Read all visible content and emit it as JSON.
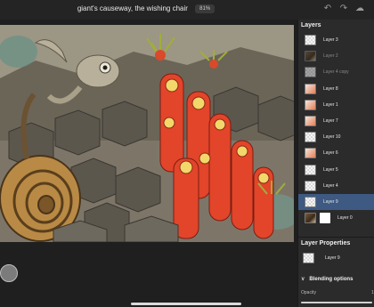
{
  "document": {
    "title": "giant's causeway, the wishing chair",
    "zoom": "81%"
  },
  "toolbar": {
    "undo_icon": "undo-icon",
    "redo_icon": "redo-icon",
    "cloud_icon": "cloud-icon"
  },
  "layers_panel": {
    "title": "Layers",
    "items": [
      {
        "label": "Layer 3",
        "thumb": "checker",
        "dim": false
      },
      {
        "label": "Layer 2",
        "thumb": "art",
        "dim": true
      },
      {
        "label": "Layer 4 copy",
        "thumb": "checker",
        "dim": true
      },
      {
        "label": "Layer 8",
        "thumb": "red",
        "dim": false
      },
      {
        "label": "Layer 1",
        "thumb": "red",
        "dim": false
      },
      {
        "label": "Layer 7",
        "thumb": "red",
        "dim": false
      },
      {
        "label": "Layer 10",
        "thumb": "checker",
        "dim": false
      },
      {
        "label": "Layer 6",
        "thumb": "red",
        "dim": false
      },
      {
        "label": "Layer 5",
        "thumb": "checker",
        "dim": false
      },
      {
        "label": "Layer 4",
        "thumb": "checker",
        "dim": false
      },
      {
        "label": "Layer 9",
        "thumb": "checker",
        "dim": false,
        "selected": true
      },
      {
        "label": "Layer 0",
        "thumb": "art",
        "dim": false,
        "mask": true
      }
    ]
  },
  "layer_properties": {
    "title": "Layer Properties",
    "layer_name": "Layer 9",
    "blending_title": "Blending options",
    "opacity_label": "Opacity",
    "opacity_value": "1",
    "opacity_level": 1.0
  },
  "colors": {
    "selected_row": "#3e5a82",
    "panel_bg": "#2b2b2b",
    "app_bg": "#1f1f1f"
  }
}
